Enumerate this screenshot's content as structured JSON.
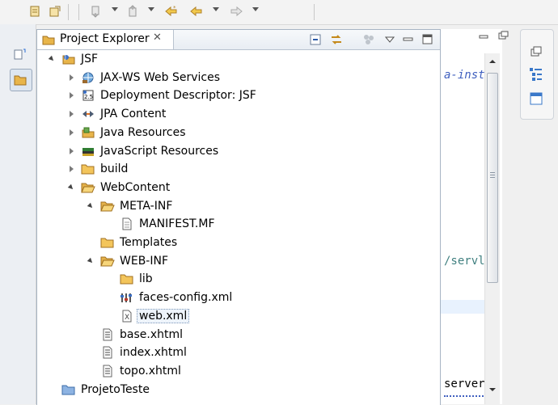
{
  "view": {
    "tab_label": "Project Explorer",
    "close_glyph": "✕"
  },
  "editor": {
    "lines": [
      "a-inst",
      "/servl",
      "server"
    ]
  },
  "tree": [
    {
      "label": "JSF",
      "icon": "java-project-icon",
      "twisty": "open"
    },
    {
      "label": "JAX-WS Web Services",
      "icon": "webservices-icon",
      "twisty": "closed"
    },
    {
      "label": "Deployment Descriptor: JSF",
      "icon": "deployment-descriptor-icon",
      "twisty": "closed"
    },
    {
      "label": "JPA Content",
      "icon": "jpa-icon",
      "twisty": "closed"
    },
    {
      "label": "Java Resources",
      "icon": "java-resources-icon",
      "twisty": "closed"
    },
    {
      "label": "JavaScript Resources",
      "icon": "javascript-resources-icon",
      "twisty": "closed"
    },
    {
      "label": "build",
      "icon": "folder-icon",
      "twisty": "closed"
    },
    {
      "label": "WebContent",
      "icon": "folder-open-icon",
      "twisty": "open"
    },
    {
      "label": "META-INF",
      "icon": "folder-open-icon",
      "twisty": "open"
    },
    {
      "label": "MANIFEST.MF",
      "icon": "text-file-icon",
      "twisty": "none"
    },
    {
      "label": "Templates",
      "icon": "folder-icon",
      "twisty": "none"
    },
    {
      "label": "WEB-INF",
      "icon": "folder-open-icon",
      "twisty": "open"
    },
    {
      "label": "lib",
      "icon": "folder-icon",
      "twisty": "none"
    },
    {
      "label": "faces-config.xml",
      "icon": "faces-config-icon",
      "twisty": "none"
    },
    {
      "label": "web.xml",
      "icon": "xml-file-icon",
      "twisty": "none",
      "selected": true
    },
    {
      "label": "base.xhtml",
      "icon": "xhtml-file-icon",
      "twisty": "none"
    },
    {
      "label": "index.xhtml",
      "icon": "xhtml-file-icon",
      "twisty": "none"
    },
    {
      "label": "topo.xhtml",
      "icon": "xhtml-file-icon",
      "twisty": "none"
    },
    {
      "label": "ProjetoTeste",
      "icon": "project-folder-icon",
      "twisty": "none"
    }
  ],
  "colors": {
    "folder": "#e8b54a",
    "selection": "#eef4fb",
    "code": "#3f5fbf"
  }
}
